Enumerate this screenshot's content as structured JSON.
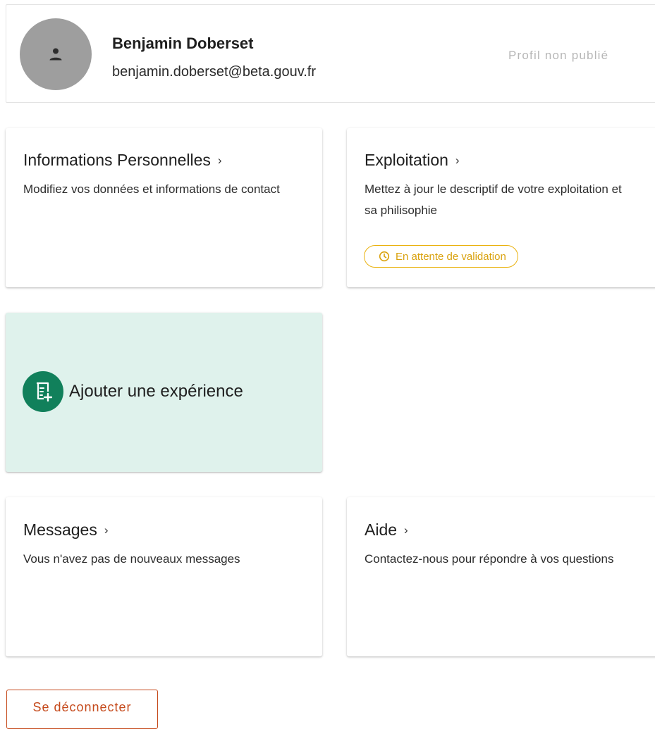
{
  "profile": {
    "name": "Benjamin Doberset",
    "email": "benjamin.doberset@beta.gouv.fr",
    "status": "Profil non publié",
    "avatar_icon": "person-icon"
  },
  "cards": {
    "informations": {
      "title": "Informations Personnelles",
      "description": "Modifiez vos données et informations de contact"
    },
    "exploitation": {
      "title": "Exploitation",
      "description": "Mettez à jour le descriptif de votre exploitation et sa philisophie",
      "badge": "En attente de validation",
      "badge_icon": "clock-icon"
    },
    "experience": {
      "label": "Ajouter une expérience",
      "icon": "add-experience-icon"
    },
    "messages": {
      "title": "Messages",
      "description": "Vous n'avez pas de nouveaux messages"
    },
    "aide": {
      "title": "Aide",
      "description": "Contactez-nous pour répondre à vos questions"
    }
  },
  "logout": {
    "label": "Se déconnecter"
  },
  "colors": {
    "accent_green": "#11805b",
    "experience_bg": "#dff2ec",
    "warning": "#eab20e",
    "logout": "#c54a1c"
  }
}
